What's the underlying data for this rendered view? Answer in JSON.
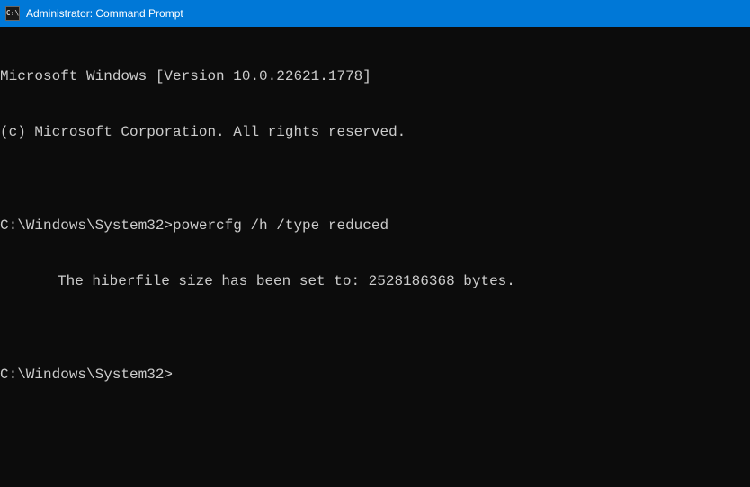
{
  "titlebar": {
    "icon_glyph": "C:\\",
    "title": "Administrator: Command Prompt"
  },
  "terminal": {
    "line1": "Microsoft Windows [Version 10.0.22621.1778]",
    "line2": "(c) Microsoft Corporation. All rights reserved.",
    "blank1": "",
    "prompt1": "C:\\Windows\\System32>",
    "command1": "powercfg /h /type reduced",
    "output1": "The hiberfile size has been set to: 2528186368 bytes.",
    "blank2": "",
    "prompt2": "C:\\Windows\\System32>"
  }
}
